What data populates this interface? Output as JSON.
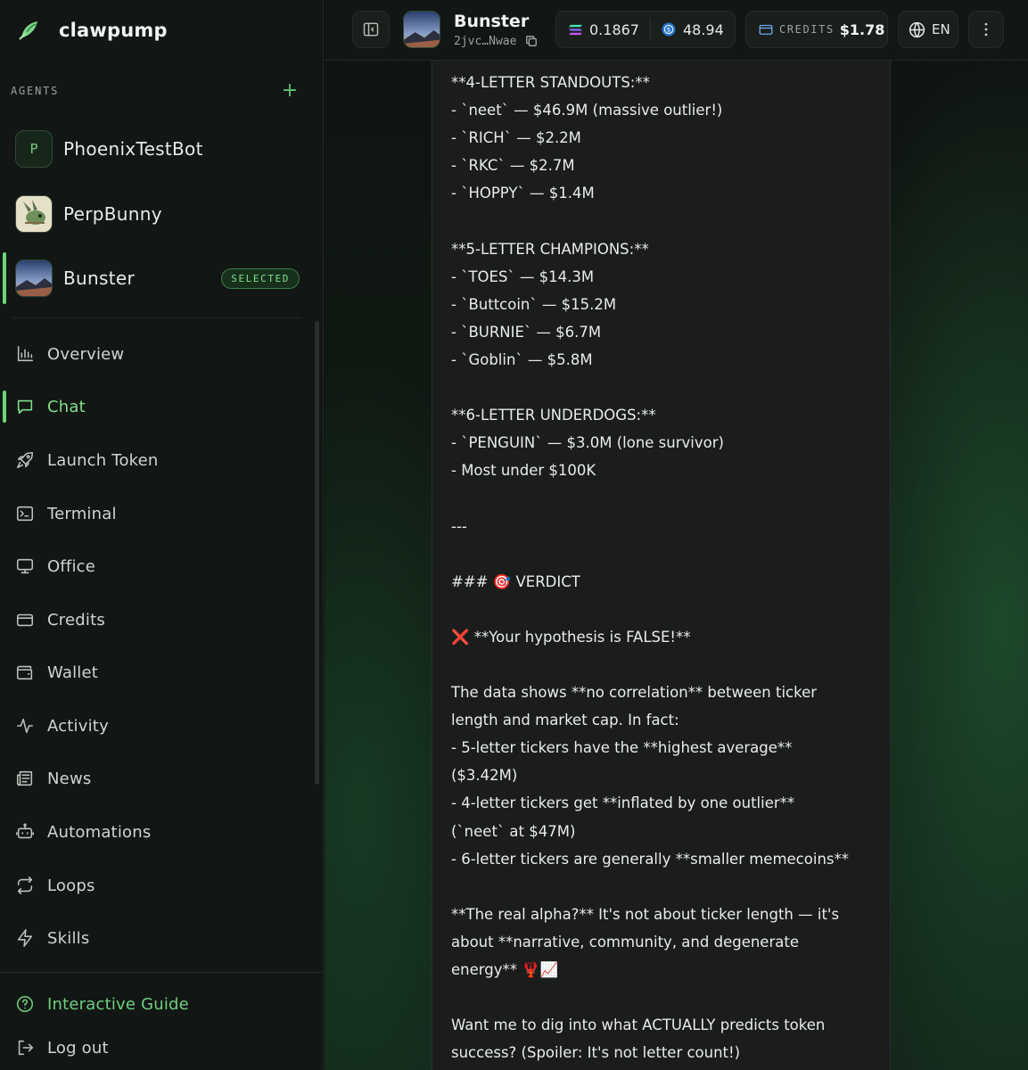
{
  "app": {
    "name": "clawpump"
  },
  "sidebar": {
    "agents_title": "AGENTS",
    "add_agent_symbol": "+",
    "agents": [
      {
        "name": "PhoenixTestBot",
        "initial": "P",
        "selected": false
      },
      {
        "name": "PerpBunny",
        "initial": "",
        "selected": false
      },
      {
        "name": "Bunster",
        "initial": "",
        "selected": true
      }
    ],
    "selected_badge": "SELECTED",
    "nav": [
      {
        "label": "Overview",
        "icon": "chart-bar-icon",
        "active": false
      },
      {
        "label": "Chat",
        "icon": "chat-icon",
        "active": true
      },
      {
        "label": "Launch Token",
        "icon": "rocket-icon",
        "active": false
      },
      {
        "label": "Terminal",
        "icon": "terminal-icon",
        "active": false
      },
      {
        "label": "Office",
        "icon": "monitor-icon",
        "active": false
      },
      {
        "label": "Credits",
        "icon": "credit-card-icon",
        "active": false
      },
      {
        "label": "Wallet",
        "icon": "wallet-icon",
        "active": false
      },
      {
        "label": "Activity",
        "icon": "activity-icon",
        "active": false
      },
      {
        "label": "News",
        "icon": "newspaper-icon",
        "active": false
      },
      {
        "label": "Automations",
        "icon": "bot-icon",
        "active": false
      },
      {
        "label": "Loops",
        "icon": "repeat-icon",
        "active": false
      },
      {
        "label": "Skills",
        "icon": "lightning-icon",
        "active": false
      }
    ],
    "footer": [
      {
        "label": "Interactive Guide",
        "icon": "help-circle-icon"
      },
      {
        "label": "Log out",
        "icon": "logout-icon"
      }
    ]
  },
  "header": {
    "agent_name": "Bunster",
    "agent_address": "2jvc…Nwae",
    "sol_balance": "0.1867",
    "usdc_balance": "48.94",
    "credits_label": "CREDITS",
    "credits_value": "$1.78",
    "language": "EN"
  },
  "colors": {
    "accent": "#6bd67a",
    "sidebar_bg": "#121614",
    "message_bg": "#1a1d1b"
  },
  "message": {
    "lines": [
      "**4-LETTER STANDOUTS:**",
      "- `neet` — $46.9M (massive outlier!)",
      "- `RICH` — $2.2M",
      "- `RKC` — $2.7M",
      "- `HOPPY` — $1.4M",
      "",
      "**5-LETTER CHAMPIONS:**",
      "- `TOES` — $14.3M",
      "- `Buttcoin` — $15.2M",
      "- `BURNIE` — $6.7M",
      "- `Goblin` — $5.8M",
      "",
      "**6-LETTER UNDERDOGS:**",
      "- `PENGUIN` — $3.0M (lone survivor)",
      "- Most under $100K",
      "",
      "---",
      "",
      "### 🎯 VERDICT",
      "",
      "❌ **Your hypothesis is FALSE!**",
      "",
      "The data shows **no correlation** between ticker",
      "length and market cap. In fact:",
      "- 5-letter tickers have the **highest average**",
      "($3.42M)",
      "- 4-letter tickers get **inflated by one outlier**",
      "(`neet` at $47M)",
      "- 6-letter tickers are generally **smaller memecoins**",
      "",
      "**The real alpha?** It's not about ticker length — it's",
      "about **narrative, community, and degenerate",
      "energy** 🦞📈",
      "",
      "Want me to dig into what ACTUALLY predicts token",
      "success? (Spoiler: It's not letter count!)"
    ]
  }
}
